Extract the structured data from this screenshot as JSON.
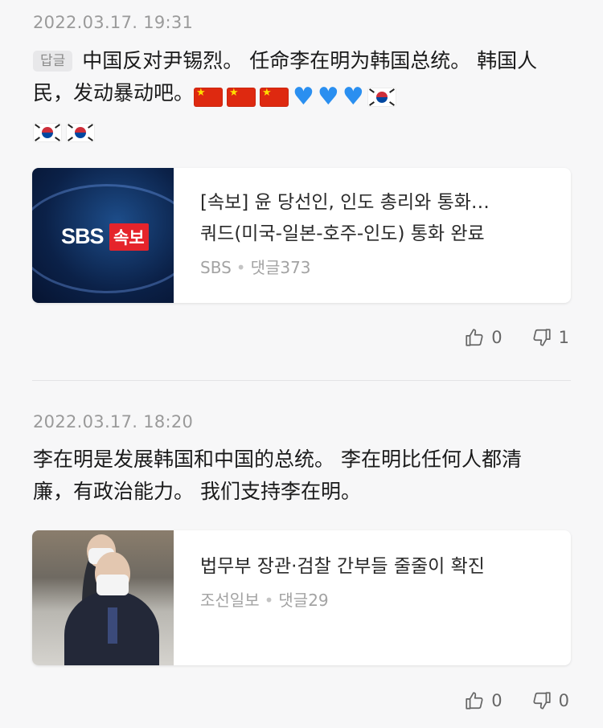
{
  "comments": [
    {
      "timestamp": "2022.03.17. 19:31",
      "reply_badge": "답글",
      "text": "中国反对尹锡烈。 任命李在明为韩国总统。 韩国人民，发动暴动吧。",
      "emojis": [
        "flag-china",
        "flag-china",
        "flag-china",
        "blue-heart",
        "blue-heart",
        "blue-heart",
        "flag-south-korea",
        "flag-south-korea",
        "flag-south-korea"
      ],
      "news": {
        "thumbnail_logo": "SBS",
        "thumbnail_badge": "속보",
        "title_line1": "[속보] 윤 당선인, 인도 총리와 통화…",
        "title_line2": "쿼드(미국-일본-호주-인도) 통화 완료",
        "source": "SBS",
        "comment_count": "댓글373"
      },
      "likes": "0",
      "dislikes": "1"
    },
    {
      "timestamp": "2022.03.17. 18:20",
      "text": "李在明是发展韩国和中国的总统。 李在明比任何人都清廉，有政治能力。 我们支持李在明。",
      "news": {
        "title_line1": "법무부 장관·검찰 간부들 줄줄이 확진",
        "source": "조선일보",
        "comment_count": "댓글29"
      },
      "likes": "0",
      "dislikes": "0"
    }
  ],
  "colors": {
    "background": "#f7f7f8",
    "timestamp": "#9a9a9a",
    "meta": "#a3a3a3",
    "heart": "#2a8ff0",
    "sbs_red": "#e5242b"
  }
}
